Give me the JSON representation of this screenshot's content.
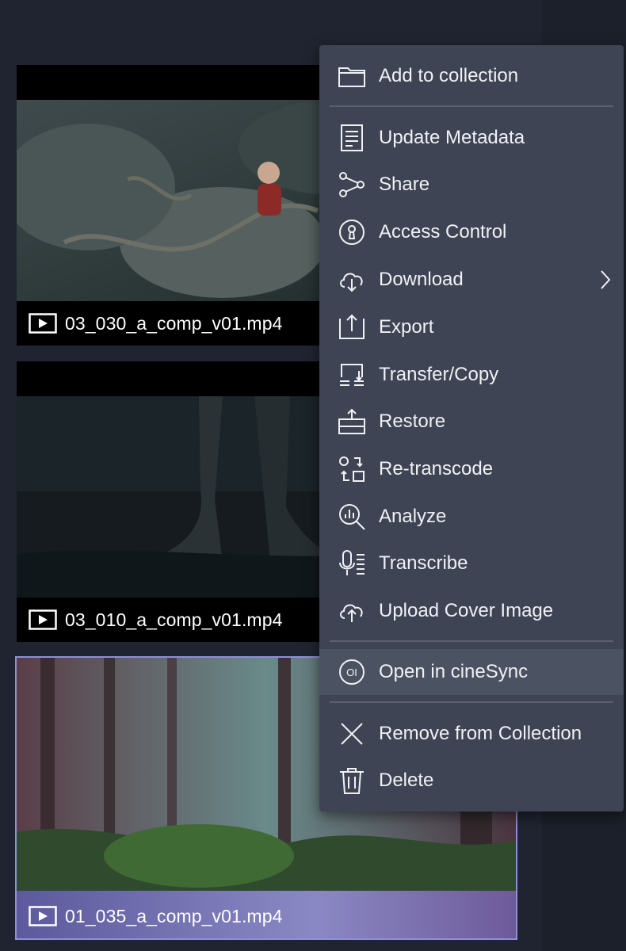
{
  "assets": [
    {
      "filename": "03_030_a_comp_v01.mp4"
    },
    {
      "filename": "03_010_a_comp_v01.mp4"
    },
    {
      "filename": "01_035_a_comp_v01.mp4"
    }
  ],
  "menu": {
    "items": [
      {
        "label": "Add to collection",
        "icon": "folder-icon"
      },
      {
        "label": "Update Metadata",
        "icon": "document-icon"
      },
      {
        "label": "Share",
        "icon": "share-icon"
      },
      {
        "label": "Access Control",
        "icon": "lock-icon"
      },
      {
        "label": "Download",
        "icon": "cloud-download-icon"
      },
      {
        "label": "Export",
        "icon": "export-icon"
      },
      {
        "label": "Transfer/Copy",
        "icon": "transfer-icon"
      },
      {
        "label": "Restore",
        "icon": "restore-icon"
      },
      {
        "label": "Re-transcode",
        "icon": "retranscode-icon"
      },
      {
        "label": "Analyze",
        "icon": "analyze-icon"
      },
      {
        "label": "Transcribe",
        "icon": "transcribe-icon"
      },
      {
        "label": "Upload Cover Image",
        "icon": "cloud-upload-icon"
      },
      {
        "label": "Open in cineSync",
        "icon": "cinesync-icon",
        "icon_text": "OI"
      },
      {
        "label": "Remove from Collection",
        "icon": "close-icon"
      },
      {
        "label": "Delete",
        "icon": "trash-icon"
      }
    ]
  },
  "colors": {
    "menu_bg": "#3e4454",
    "menu_hover": "#4b5262",
    "selection_outline": "#8e8fd4",
    "page_bg": "#1f2430"
  }
}
